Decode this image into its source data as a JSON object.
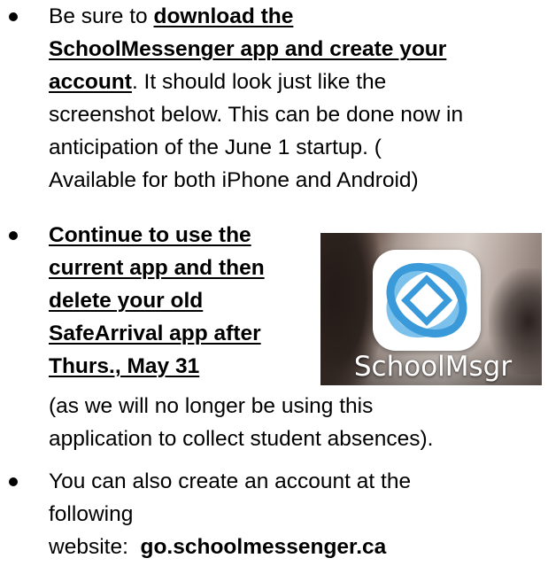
{
  "bullets": [
    {
      "lines": [
        [
          {
            "text": "Be sure to ",
            "style": "normal"
          },
          {
            "text": "download the",
            "style": "bold-underline"
          }
        ],
        [
          {
            "text": "SchoolMessenger app and create your",
            "style": "bold-underline"
          }
        ],
        [
          {
            "text": "account",
            "style": "bold-underline"
          },
          {
            "text": ". It should look just like the",
            "style": "normal"
          }
        ],
        [
          {
            "text": "screenshot below. This can be done now in",
            "style": "normal"
          }
        ],
        [
          {
            "text": "anticipation of the June 1 startup. (",
            "style": "normal"
          }
        ],
        [
          {
            "text": "Available for both iPhone and Android)",
            "style": "normal"
          }
        ]
      ]
    },
    {
      "lines": [
        [
          {
            "text": "Continue to use the",
            "style": "bold-underline"
          }
        ],
        [
          {
            "text": "current app and then",
            "style": "bold-underline"
          }
        ],
        [
          {
            "text": "delete your old",
            "style": "bold-underline"
          }
        ],
        [
          {
            "text": "SafeArrival app after",
            "style": "bold-underline"
          }
        ],
        [
          {
            "text": "Thurs., May 31",
            "style": "bold-underline"
          }
        ],
        [
          {
            "text": "(as we will no longer be using this",
            "style": "normal"
          }
        ],
        [
          {
            "text": "application to collect student absences).",
            "style": "normal"
          }
        ]
      ]
    },
    {
      "lines": [
        [
          {
            "text": "You can also create an account at the",
            "style": "normal"
          }
        ],
        [
          {
            "text": "following",
            "style": "normal"
          }
        ],
        [
          {
            "text": "website:  ",
            "style": "normal"
          },
          {
            "text": "go.schoolmessenger.ca",
            "style": "bold"
          }
        ]
      ]
    }
  ],
  "app_icon": {
    "label": "SchoolMsgr",
    "icon_name": "schoolmessenger-app-icon",
    "accent_color": "#3a9ad9",
    "accent_light": "#7cc0ec"
  }
}
